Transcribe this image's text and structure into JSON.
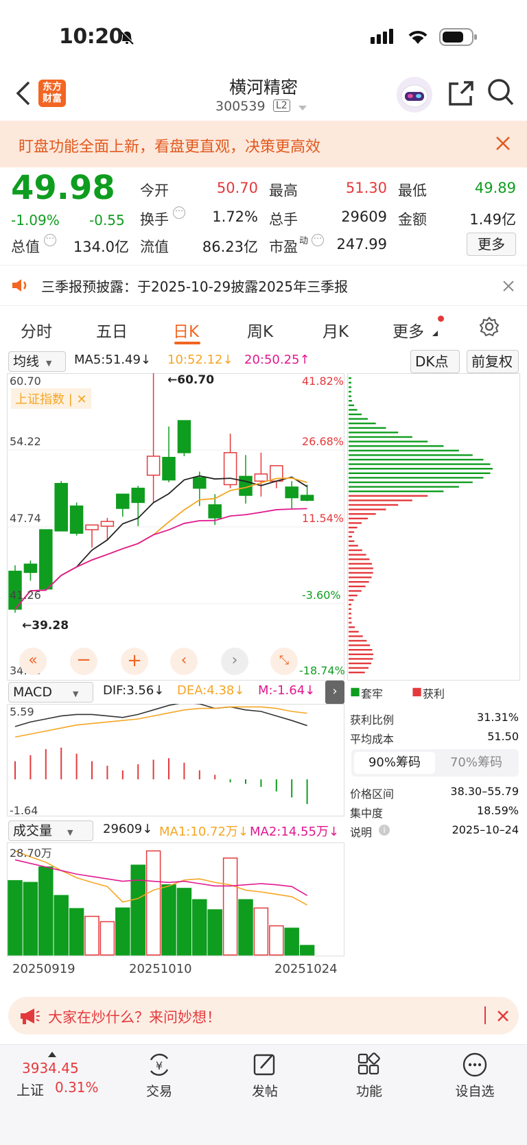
{
  "status": {
    "time": "10:20"
  },
  "header": {
    "title": "横河精密",
    "code": "300539",
    "level": "L2",
    "logo_line1": "东方",
    "logo_line2": "财富"
  },
  "banner": {
    "text": "盯盘功能全面上新，看盘更直观，决策更高效"
  },
  "quote": {
    "price": "49.98",
    "pct": "-1.09%",
    "chg": "-0.55",
    "open_label": "今开",
    "open": "50.70",
    "high_label": "最高",
    "high": "51.30",
    "low_label": "最低",
    "low": "49.89",
    "turnover_label": "换手",
    "turnover": "1.72%",
    "vol_label": "总手",
    "vol": "29609",
    "amt_label": "金额",
    "amt": "1.49亿",
    "mcap_label": "总值",
    "mcap": "134.0亿",
    "float_label": "流值",
    "float": "86.23亿",
    "pe_label": "市盈",
    "pe_sup": "动",
    "pe": "247.99",
    "more": "更多"
  },
  "notice": {
    "text": "三季报预披露：于2025-10-29披露2025年三季报"
  },
  "tabs": [
    "分时",
    "五日",
    "日K",
    "周K",
    "月K",
    "更多"
  ],
  "kline": {
    "ma_select": "均线",
    "ma5": "MA5:51.49↓",
    "ma10": "10:52.12↓",
    "ma20": "20:50.25↑",
    "dk": "DK点",
    "fq": "前复权",
    "y_top": "60.70",
    "y_2": "54.22",
    "y_3": "47.74",
    "y_4": "41.26",
    "y_bot": "34.78",
    "p_top": "41.82%",
    "p_2": "26.68%",
    "p_3": "11.54%",
    "p_4": "-3.60%",
    "p_bot": "-18.74%",
    "max_label": "←60.70",
    "min_label": "←39.28",
    "index_tag": "上证指数 | ✕",
    "watermark": "东方财富"
  },
  "chart_data": {
    "type": "candlestick",
    "dates_shown": [
      "20250919",
      "20251010",
      "20251024"
    ],
    "ohlc": [
      [
        44.0,
        44.5,
        40.5,
        40.8
      ],
      [
        44.6,
        44.9,
        43.2,
        43.9
      ],
      [
        47.5,
        47.5,
        42.5,
        42.5
      ],
      [
        51.4,
        51.6,
        47.4,
        47.4
      ],
      [
        49.5,
        49.8,
        47.0,
        47.2
      ],
      [
        47.5,
        47.9,
        46.0,
        47.9
      ],
      [
        47.8,
        48.5,
        46.6,
        48.2
      ],
      [
        50.5,
        50.5,
        48.6,
        49.3
      ],
      [
        51.0,
        51.2,
        47.8,
        49.8
      ],
      [
        52.1,
        60.7,
        49.8,
        53.7
      ],
      [
        53.6,
        56.2,
        51.5,
        51.7
      ],
      [
        56.7,
        56.7,
        53.7,
        54.0
      ],
      [
        51.9,
        52.4,
        49.5,
        51.0
      ],
      [
        49.6,
        50.5,
        47.9,
        48.5
      ],
      [
        51.3,
        55.6,
        51.0,
        54.0
      ],
      [
        52.0,
        53.8,
        49.7,
        50.4
      ],
      [
        51.6,
        54.0,
        50.3,
        52.2
      ],
      [
        51.6,
        52.6,
        51.0,
        52.9
      ],
      [
        51.1,
        51.6,
        49.3,
        50.2
      ],
      [
        50.4,
        51.3,
        49.9,
        49.98
      ]
    ]
  },
  "macd": {
    "select": "MACD",
    "dif": "DIF:3.56↓",
    "dea": "DEA:4.38↓",
    "m": "M:-1.64↓",
    "top": "5.59",
    "bot": "-1.64"
  },
  "volume": {
    "select": "成交量",
    "vol": "29609↓",
    "ma1": "MA1:10.72万↓",
    "ma2": "MA2:14.55万↓",
    "top": "28.70万",
    "date1": "20250919",
    "date2": "20251010",
    "date3": "20251024"
  },
  "chips": {
    "legend_hold": "套牢",
    "legend_profit": "获利",
    "profit_ratio_label": "获利比例",
    "profit_ratio": "31.31%",
    "avg_cost_label": "平均成本",
    "avg_cost": "51.50",
    "tab90": "90%筹码",
    "tab70": "70%筹码",
    "range_label": "价格区间",
    "range": "38.30–55.79",
    "conc_label": "集中度",
    "conc": "18.59%",
    "desc_label": "说明",
    "desc_date": "2025–10–24"
  },
  "chip_bar": {
    "text": "大家在炒什么？来问妙想！"
  },
  "bottom": {
    "index_val": "3934.45",
    "index_name": "上证",
    "index_pct": "0.31%",
    "trade": "交易",
    "post": "发帖",
    "func": "功能",
    "watch": "设自选"
  },
  "colors": {
    "red": "#e4393c",
    "green": "#0f9d1f",
    "ma10": "#f5a623",
    "ma20": "#e0188f"
  }
}
